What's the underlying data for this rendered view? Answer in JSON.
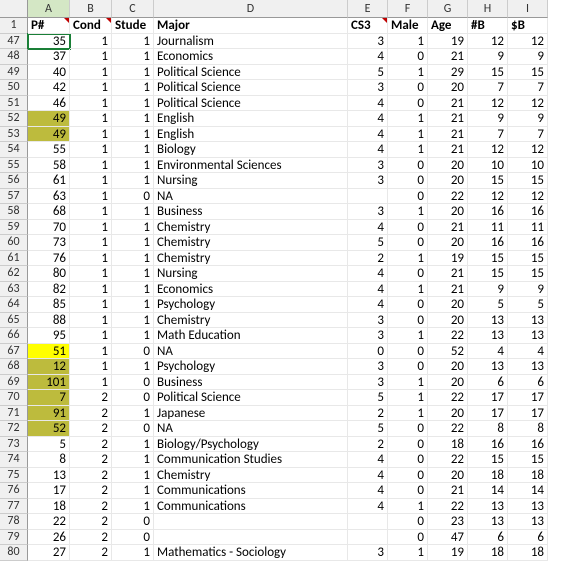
{
  "columns": [
    "A",
    "B",
    "C",
    "D",
    "E",
    "F",
    "G",
    "H",
    "I"
  ],
  "header_row_num": 1,
  "headers": {
    "A": "P#",
    "B": "Cond",
    "C": "Stude",
    "D": "Major",
    "E": "CS3",
    "F": "Male",
    "G": "Age",
    "H": "#B",
    "I": "$B"
  },
  "note_cols": [
    "A",
    "B",
    "E"
  ],
  "highlight_olive": [
    [
      "52",
      "A"
    ],
    [
      "53",
      "A"
    ],
    [
      "68",
      "A"
    ],
    [
      "69",
      "A"
    ],
    [
      "70",
      "A"
    ],
    [
      "71",
      "A"
    ],
    [
      "72",
      "A"
    ]
  ],
  "highlight_yellow": [
    [
      "67",
      "A"
    ]
  ],
  "active_cell": [
    "47",
    "A"
  ],
  "sel_col": "A",
  "rows": [
    {
      "n": 47,
      "A": 35,
      "B": 1,
      "C": 1,
      "D": "Journalism",
      "E": 3,
      "F": 1,
      "G": 19,
      "H": 12,
      "I": 12
    },
    {
      "n": 48,
      "A": 37,
      "B": 1,
      "C": 1,
      "D": "Economics",
      "E": 4,
      "F": 0,
      "G": 21,
      "H": 9,
      "I": 9
    },
    {
      "n": 49,
      "A": 40,
      "B": 1,
      "C": 1,
      "D": "Political Science",
      "E": 5,
      "F": 1,
      "G": 29,
      "H": 15,
      "I": 15
    },
    {
      "n": 50,
      "A": 42,
      "B": 1,
      "C": 1,
      "D": "Political Science",
      "E": 3,
      "F": 0,
      "G": 20,
      "H": 7,
      "I": 7
    },
    {
      "n": 51,
      "A": 46,
      "B": 1,
      "C": 1,
      "D": "Political Science",
      "E": 4,
      "F": 0,
      "G": 21,
      "H": 12,
      "I": 12
    },
    {
      "n": 52,
      "A": 49,
      "B": 1,
      "C": 1,
      "D": "English",
      "E": 4,
      "F": 1,
      "G": 21,
      "H": 9,
      "I": 9
    },
    {
      "n": 53,
      "A": 49,
      "B": 1,
      "C": 1,
      "D": "English",
      "E": 4,
      "F": 1,
      "G": 21,
      "H": 7,
      "I": 7
    },
    {
      "n": 54,
      "A": 55,
      "B": 1,
      "C": 1,
      "D": "Biology",
      "E": 4,
      "F": 1,
      "G": 21,
      "H": 12,
      "I": 12
    },
    {
      "n": 55,
      "A": 58,
      "B": 1,
      "C": 1,
      "D": "Environmental Sciences",
      "E": 3,
      "F": 0,
      "G": 20,
      "H": 10,
      "I": 10
    },
    {
      "n": 56,
      "A": 61,
      "B": 1,
      "C": 1,
      "D": "Nursing",
      "E": 3,
      "F": 0,
      "G": 20,
      "H": 15,
      "I": 15
    },
    {
      "n": 57,
      "A": 63,
      "B": 1,
      "C": 0,
      "D": "NA",
      "E": "",
      "F": 0,
      "G": 22,
      "H": 12,
      "I": 12
    },
    {
      "n": 58,
      "A": 68,
      "B": 1,
      "C": 1,
      "D": "Business",
      "E": 3,
      "F": 1,
      "G": 20,
      "H": 16,
      "I": 16
    },
    {
      "n": 59,
      "A": 70,
      "B": 1,
      "C": 1,
      "D": "Chemistry",
      "E": 4,
      "F": 0,
      "G": 21,
      "H": 11,
      "I": 11
    },
    {
      "n": 60,
      "A": 73,
      "B": 1,
      "C": 1,
      "D": "Chemistry",
      "E": 5,
      "F": 0,
      "G": 20,
      "H": 16,
      "I": 16
    },
    {
      "n": 61,
      "A": 76,
      "B": 1,
      "C": 1,
      "D": "Chemistry",
      "E": 2,
      "F": 1,
      "G": 19,
      "H": 15,
      "I": 15
    },
    {
      "n": 62,
      "A": 80,
      "B": 1,
      "C": 1,
      "D": "Nursing",
      "E": 4,
      "F": 0,
      "G": 21,
      "H": 15,
      "I": 15
    },
    {
      "n": 63,
      "A": 82,
      "B": 1,
      "C": 1,
      "D": "Economics",
      "E": 4,
      "F": 1,
      "G": 21,
      "H": 9,
      "I": 9
    },
    {
      "n": 64,
      "A": 85,
      "B": 1,
      "C": 1,
      "D": "Psychology",
      "E": 4,
      "F": 0,
      "G": 20,
      "H": 5,
      "I": 5
    },
    {
      "n": 65,
      "A": 88,
      "B": 1,
      "C": 1,
      "D": "Chemistry",
      "E": 3,
      "F": 0,
      "G": 20,
      "H": 13,
      "I": 13
    },
    {
      "n": 66,
      "A": 95,
      "B": 1,
      "C": 1,
      "D": "Math Education",
      "E": 3,
      "F": 1,
      "G": 22,
      "H": 13,
      "I": 13
    },
    {
      "n": 67,
      "A": 51,
      "B": 1,
      "C": 0,
      "D": "NA",
      "E": 0,
      "F": 0,
      "G": 52,
      "H": 4,
      "I": 4
    },
    {
      "n": 68,
      "A": 12,
      "B": 1,
      "C": 1,
      "D": "Psychology",
      "E": 3,
      "F": 0,
      "G": 20,
      "H": 13,
      "I": 13
    },
    {
      "n": 69,
      "A": 101,
      "B": 1,
      "C": 0,
      "D": "Business",
      "E": 3,
      "F": 1,
      "G": 20,
      "H": 6,
      "I": 6
    },
    {
      "n": 70,
      "A": 7,
      "B": 2,
      "C": 0,
      "D": "Political Science",
      "E": 5,
      "F": 1,
      "G": 22,
      "H": 17,
      "I": 17
    },
    {
      "n": 71,
      "A": 91,
      "B": 2,
      "C": 1,
      "D": "Japanese",
      "E": 2,
      "F": 1,
      "G": 20,
      "H": 17,
      "I": 17
    },
    {
      "n": 72,
      "A": 52,
      "B": 2,
      "C": 0,
      "D": "NA",
      "E": 5,
      "F": 0,
      "G": 22,
      "H": 8,
      "I": 8
    },
    {
      "n": 73,
      "A": 5,
      "B": 2,
      "C": 1,
      "D": "Biology/Psychology",
      "E": 2,
      "F": 0,
      "G": 18,
      "H": 16,
      "I": 16
    },
    {
      "n": 74,
      "A": 8,
      "B": 2,
      "C": 1,
      "D": "Communication Studies",
      "E": 4,
      "F": 0,
      "G": 22,
      "H": 15,
      "I": 15
    },
    {
      "n": 75,
      "A": 13,
      "B": 2,
      "C": 1,
      "D": "Chemistry",
      "E": 4,
      "F": 0,
      "G": 20,
      "H": 18,
      "I": 18
    },
    {
      "n": 76,
      "A": 17,
      "B": 2,
      "C": 1,
      "D": "Communications",
      "E": 4,
      "F": 0,
      "G": 21,
      "H": 14,
      "I": 14
    },
    {
      "n": 77,
      "A": 18,
      "B": 2,
      "C": 1,
      "D": "Communications",
      "E": 4,
      "F": 1,
      "G": 22,
      "H": 13,
      "I": 13
    },
    {
      "n": 78,
      "A": 22,
      "B": 2,
      "C": 0,
      "D": "",
      "E": "",
      "F": 0,
      "G": 23,
      "H": 13,
      "I": 13
    },
    {
      "n": 79,
      "A": 26,
      "B": 2,
      "C": 0,
      "D": "",
      "E": "",
      "F": 0,
      "G": 47,
      "H": 6,
      "I": 6
    },
    {
      "n": 80,
      "A": 27,
      "B": 2,
      "C": 1,
      "D": "Mathematics - Sociology",
      "E": 3,
      "F": 1,
      "G": 19,
      "H": 18,
      "I": 18
    }
  ]
}
